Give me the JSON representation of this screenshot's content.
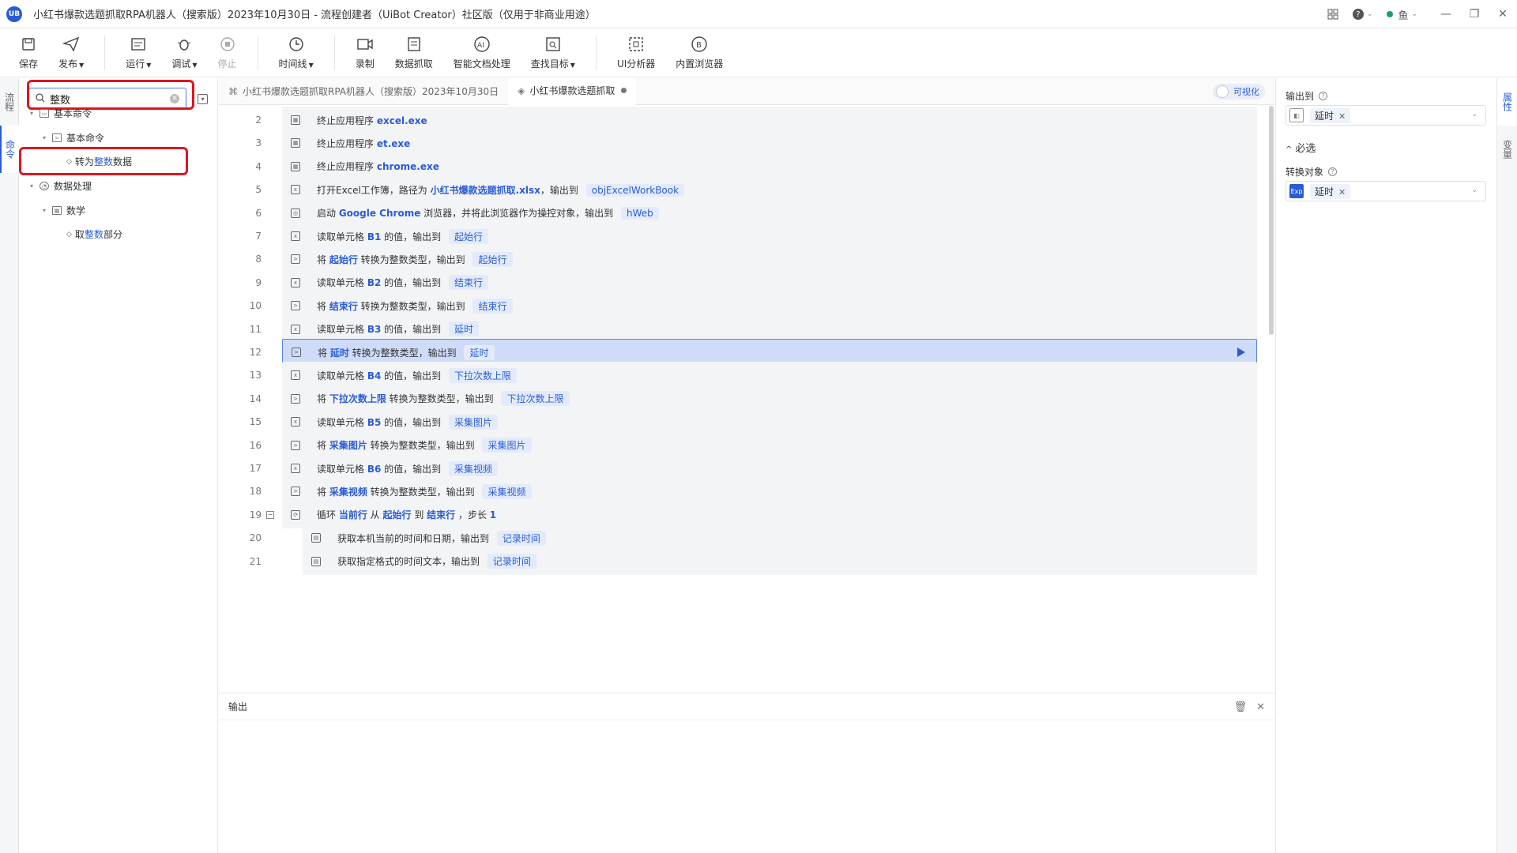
{
  "window": {
    "logo": "UB",
    "title": "小红书爆款选题抓取RPA机器人（搜索版）2023年10月30日 - 流程创建者（UiBot Creator）社区版（仅用于非商业用途）",
    "user": "鱼",
    "colors": {
      "accent": "#2a5bd7",
      "selected_row": "#cfdcf9",
      "highlight_box": "#e0141e"
    }
  },
  "toolbar": {
    "save": "保存",
    "publish": "发布",
    "run": "运行",
    "debug": "调试",
    "stop": "停止",
    "timeline": "时间线",
    "record": "录制",
    "data_scrape": "数据抓取",
    "smart_doc": "智能文档处理",
    "find_target": "查找目标",
    "ui_analyzer": "UI分析器",
    "builtin_browser": "内置浏览器"
  },
  "left_rail": {
    "flow_tab": "流程",
    "command_tab": "命令"
  },
  "command_panel": {
    "search_value": "整数",
    "tree": {
      "basic_root": "基本命令",
      "basic_sub": "基本命令",
      "to_int_prefix": "转为",
      "to_int_match": "整数",
      "to_int_suffix": "数据",
      "data_processing": "数据处理",
      "math": "数学",
      "int_part_prefix": "取",
      "int_part_match": "整数",
      "int_part_suffix": "部分"
    }
  },
  "tabs": {
    "tab1": "小红书爆款选题抓取RPA机器人（搜索版）2023年10月30日",
    "tab2": "小红书爆款选题抓取",
    "visualize": "可视化"
  },
  "code_rows": [
    {
      "ln": "2",
      "t1": "终止应用程序 ",
      "k1": "excel.exe"
    },
    {
      "ln": "3",
      "t1": "终止应用程序 ",
      "k1": "et.exe"
    },
    {
      "ln": "4",
      "t1": "终止应用程序 ",
      "k1": "chrome.exe"
    },
    {
      "ln": "5",
      "t1": "打开Excel工作簿，路径为 ",
      "k1": "小红书爆款选题抓取.xlsx",
      "t2": "，输出到 ",
      "v1": "objExcelWorkBook"
    },
    {
      "ln": "6",
      "t1": "启动 ",
      "k1": "Google Chrome",
      "t2": " 浏览器，并将此浏览器作为操控对象，输出到 ",
      "v1": "hWeb"
    },
    {
      "ln": "7",
      "t1": "读取单元格 ",
      "k1": "B1",
      "t2": " 的值，输出到 ",
      "v1": "起始行"
    },
    {
      "ln": "8",
      "t1": "将 ",
      "k1": "起始行",
      "t2": " 转换为整数类型，输出到 ",
      "v1": "起始行"
    },
    {
      "ln": "9",
      "t1": "读取单元格 ",
      "k1": "B2",
      "t2": " 的值，输出到 ",
      "v1": "结束行"
    },
    {
      "ln": "10",
      "t1": "将 ",
      "k1": "结束行",
      "t2": " 转换为整数类型，输出到 ",
      "v1": "结束行"
    },
    {
      "ln": "11",
      "t1": "读取单元格 ",
      "k1": "B3",
      "t2": " 的值，输出到 ",
      "v1": "延时"
    },
    {
      "ln": "12",
      "t1": "将 ",
      "k1": "延时",
      "t2": " 转换为整数类型，输出到 ",
      "v1": "延时"
    },
    {
      "ln": "13",
      "t1": "读取单元格 ",
      "k1": "B4",
      "t2": " 的值，输出到 ",
      "v1": "下拉次数上限"
    },
    {
      "ln": "14",
      "t1": "将 ",
      "k1": "下拉次数上限",
      "t2": " 转换为整数类型，输出到 ",
      "v1": "下拉次数上限"
    },
    {
      "ln": "15",
      "t1": "读取单元格 ",
      "k1": "B5",
      "t2": " 的值，输出到 ",
      "v1": "采集图片"
    },
    {
      "ln": "16",
      "t1": "将 ",
      "k1": "采集图片",
      "t2": " 转换为整数类型，输出到 ",
      "v1": "采集图片"
    },
    {
      "ln": "17",
      "t1": "读取单元格 ",
      "k1": "B6",
      "t2": " 的值，输出到 ",
      "v1": "采集视频"
    },
    {
      "ln": "18",
      "t1": "将 ",
      "k1": "采集视频",
      "t2": " 转换为整数类型，输出到 ",
      "v1": "采集视频"
    },
    {
      "ln": "19",
      "t1": "循环 ",
      "k1": "当前行",
      "t2": " 从 ",
      "k2": "起始行",
      "t3": " 到 ",
      "k3": "结束行",
      "t4": " ，步长 ",
      "k4": "1"
    },
    {
      "ln": "20",
      "t1": "获取本机当前的时间和日期，输出到 ",
      "v1": "记录时间"
    },
    {
      "ln": "21",
      "t1": "获取指定格式的时间文本，输出到 ",
      "v1": "记录时间"
    }
  ],
  "output_panel": {
    "title": "输出"
  },
  "properties": {
    "output_to_label": "输出到",
    "output_to_value": "延时",
    "required_section": "必选",
    "convert_target_label": "转换对象",
    "convert_target_badge": "Exp",
    "convert_target_value": "延时"
  },
  "right_rail": {
    "props_tab": "属性",
    "vars_tab": "变量"
  }
}
